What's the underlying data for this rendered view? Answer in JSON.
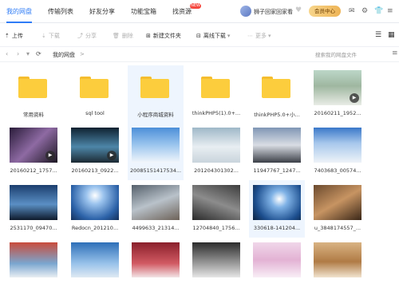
{
  "colors": {
    "accent": "#2f7cf6",
    "folder": "#fccd3d",
    "badge": "#f5483f",
    "member": "#f2c26c"
  },
  "nav": {
    "tabs": [
      {
        "label": "我的网盘"
      },
      {
        "label": "传输列表"
      },
      {
        "label": "好友分享"
      },
      {
        "label": "功能宝箱"
      },
      {
        "label": "找资源"
      }
    ],
    "new_badge": "NEW"
  },
  "user": {
    "name": "狮子回家回家看",
    "member_label": "会员中心"
  },
  "window_icons": [
    "mail-icon",
    "gear-icon",
    "shirt-icon",
    "menu-icon"
  ],
  "toolbar": {
    "upload": "上传",
    "download": "下载",
    "share": "分享",
    "delete": "删除",
    "new_folder": "新建文件夹",
    "offline": "离线下载",
    "more": "更多"
  },
  "address": {
    "breadcrumb": "我的网盘",
    "separator": ">",
    "search_placeholder": "搜索我的网盘文件"
  },
  "files": [
    {
      "name": "常用资料",
      "type": "folder"
    },
    {
      "name": "sql tool",
      "type": "folder"
    },
    {
      "name": "小程序商城资料",
      "type": "folder"
    },
    {
      "name": "thinkPHP5(1).0+...",
      "type": "folder"
    },
    {
      "name": "thinkPHP5.0+小...",
      "type": "folder"
    },
    {
      "name": "20160211_1952...",
      "type": "video"
    },
    {
      "name": "20160212_1757...",
      "type": "video"
    },
    {
      "name": "20160213_0922...",
      "type": "video"
    },
    {
      "name": "20085151417534...",
      "type": "image"
    },
    {
      "name": "201204301302...",
      "type": "image"
    },
    {
      "name": "11947767_1247...",
      "type": "image"
    },
    {
      "name": "7403683_00574...",
      "type": "image"
    },
    {
      "name": "2531170_09470...",
      "type": "image"
    },
    {
      "name": "Redocn_201210...",
      "type": "image"
    },
    {
      "name": "4499633_21314...",
      "type": "image"
    },
    {
      "name": "12704840_1756...",
      "type": "image"
    },
    {
      "name": "330618-141204...",
      "type": "image"
    },
    {
      "name": "u_3848174557_...",
      "type": "image"
    },
    {
      "name": "",
      "type": "image"
    },
    {
      "name": "",
      "type": "image"
    },
    {
      "name": "",
      "type": "image"
    },
    {
      "name": "",
      "type": "image"
    },
    {
      "name": "",
      "type": "image"
    },
    {
      "name": "",
      "type": "image"
    }
  ]
}
